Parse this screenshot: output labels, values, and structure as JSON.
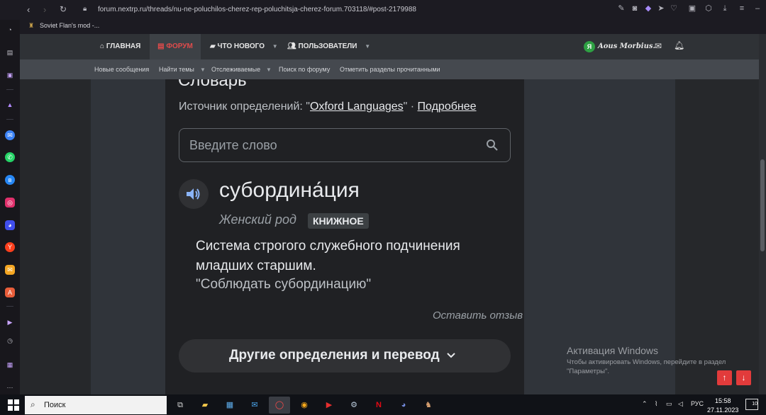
{
  "browser": {
    "url": "forum.nextrp.ru/threads/nu-ne-poluchilos-cherez-rep-poluchitsja-cherez-forum.703118/#post-2179988",
    "bookmark": "Soviet Flan's mod -..."
  },
  "forum_nav": {
    "items": [
      {
        "label": "ГЛАВНАЯ",
        "icon": "home-icon"
      },
      {
        "label": "ФОРУМ",
        "icon": "forum-icon"
      },
      {
        "label": "ЧТО НОВОГО",
        "icon": "comment-icon"
      },
      {
        "label": "ПОЛЬЗОВАТЕЛИ",
        "icon": "users-icon"
      }
    ],
    "user_name": "Aous Morbius.",
    "user_initial": "Я"
  },
  "subnav": {
    "items": [
      "Новые сообщения",
      "Найти темы",
      "Отслеживаемые",
      "Поиск по форуму",
      "Отметить разделы прочитанными"
    ]
  },
  "dictionary": {
    "title": "Словарь",
    "source_prefix": "Источник определений: \"",
    "source_link": "Oxford Languages",
    "source_suffix": "\" · ",
    "more_link": "Подробнее",
    "search_placeholder": "Введите слово",
    "word": "субордина́ция",
    "gender": "Женский род",
    "badge": "КНИЖНОЕ",
    "definition": "Система строгого служебного подчинения младших старшим.",
    "example": "\"Соблюдать субординацию\"",
    "feedback": "Оставить отзыв",
    "more_button": "Другие определения и перевод"
  },
  "windows_activation": {
    "title": "Активация Windows",
    "subtitle": "Чтобы активировать Windows, перейдите в раздел \"Параметры\"."
  },
  "taskbar": {
    "search_text": "Поиск",
    "lang": "РУС",
    "time": "15:58",
    "date": "27.11.2023",
    "notifications": "10"
  },
  "colors": {
    "accent_red": "#e23b3b",
    "dict_bg": "#202124"
  }
}
